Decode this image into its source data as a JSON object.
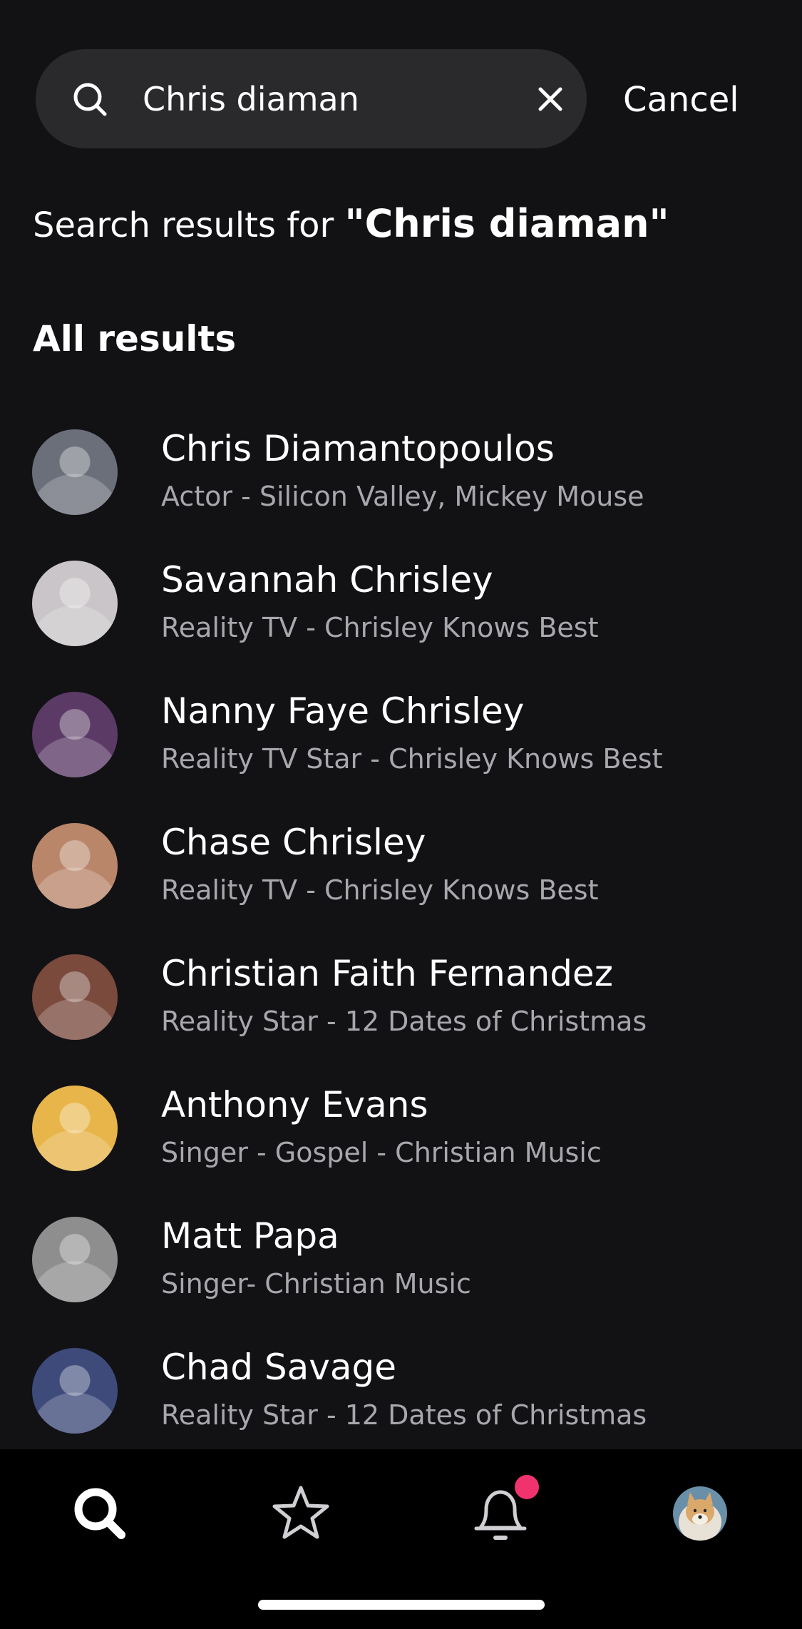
{
  "search": {
    "value": "Chris diaman",
    "cancel_label": "Cancel"
  },
  "results_heading": {
    "prefix": "Search results for ",
    "query": "\"Chris diaman\""
  },
  "section_title": "All results",
  "results": [
    {
      "name": "Chris Diamantopoulos",
      "subtitle": "Actor - Silicon Valley, Mickey Mouse",
      "avatar_color": "#6b6f7a"
    },
    {
      "name": "Savannah Chrisley",
      "subtitle": "Reality TV - Chrisley Knows Best",
      "avatar_color": "#c9c5c8"
    },
    {
      "name": "Nanny Faye Chrisley",
      "subtitle": "Reality TV Star - Chrisley Knows Best",
      "avatar_color": "#5b3a66"
    },
    {
      "name": "Chase Chrisley",
      "subtitle": "Reality TV - Chrisley Knows Best",
      "avatar_color": "#b9866a"
    },
    {
      "name": "Christian Faith Fernandez",
      "subtitle": "Reality Star - 12 Dates of Christmas",
      "avatar_color": "#7a4a3d"
    },
    {
      "name": "Anthony Evans",
      "subtitle": "Singer - Gospel - Christian Music",
      "avatar_color": "#e8b54a"
    },
    {
      "name": "Matt Papa",
      "subtitle": "Singer- Christian Music",
      "avatar_color": "#8e8e8e"
    },
    {
      "name": "Chad Savage",
      "subtitle": "Reality Star - 12 Dates of Christmas",
      "avatar_color": "#3d4a7a"
    }
  ],
  "tabs": [
    {
      "icon": "search-icon",
      "active": true
    },
    {
      "icon": "star-icon",
      "active": false
    },
    {
      "icon": "bell-icon",
      "active": false,
      "has_badge": true
    },
    {
      "icon": "profile-avatar",
      "active": false
    }
  ],
  "colors": {
    "background": "#121215",
    "search_bar": "#2a2a2d",
    "secondary_text": "#a7a7ad",
    "tab_bar": "#000000",
    "notification_badge": "#f0326e"
  }
}
